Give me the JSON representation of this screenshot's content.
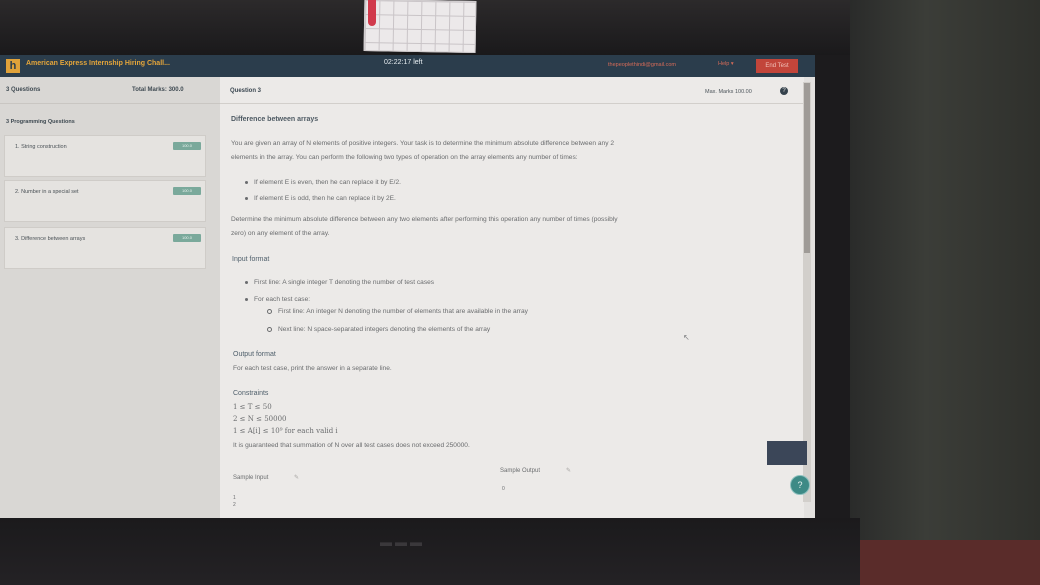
{
  "header": {
    "brand_letter": "h",
    "app_title": "American Express Internship Hiring Chall...",
    "timer": "02:22:17 left",
    "user_email": "thepeoplethindi@gmail.com",
    "help_label": "Help",
    "help_icon": "caret-down-icon",
    "end_test_label": "End Test"
  },
  "sidebar": {
    "questions_label": "3 Questions",
    "total_marks_label": "Total Marks: 300.0",
    "section_label": "3 Programming Questions",
    "items": [
      {
        "label": "1. String construction",
        "badge": "100.0"
      },
      {
        "label": "2. Number in a special set",
        "badge": "100.0"
      },
      {
        "label": "3. Difference between arrays",
        "badge": "100.0"
      }
    ]
  },
  "question": {
    "header_label": "Question 3",
    "max_marks": "Max. Marks 100.00",
    "title": "Difference between arrays",
    "intro_line1": "You are given an array of N elements of positive integers. Your task is to determine the minimum absolute difference between any 2",
    "intro_line2": "elements in the array. You can perform the following two types of operation on the array elements any number of times:",
    "ops": [
      "If element E is even, then he can replace it by E/2.",
      "If element E is odd, then he can replace it by 2E."
    ],
    "determine_line1": "Determine the minimum absolute difference between any two elements after performing this operation any number of times (possibly",
    "determine_line2": "zero) on any element of the array.",
    "input_format_title": "Input format",
    "input_first_line": "First line: A single integer T denoting the number of test cases",
    "input_for_each": "For each test case:",
    "input_sub1": "First line: An integer N denoting the number of elements that are available in the array",
    "input_sub2": "Next line: N space-separated integers denoting the elements of the array",
    "output_format_title": "Output format",
    "output_text": "For each test case, print the answer in a separate line.",
    "constraints_title": "Constraints",
    "constraints": [
      "1 ≤ T ≤ 50",
      "2 ≤ N ≤ 50000",
      "1 ≤ A[i] ≤ 10⁹ for each valid i",
      "It is guaranteed that summation of N over all test cases does not exceed 250000."
    ],
    "sample_input_label": "Sample Input",
    "sample_output_label": "Sample Output",
    "sample_input_values": [
      "1",
      "2"
    ],
    "sample_output_value": "0"
  },
  "colors": {
    "topbar": "#2b3d4c",
    "brand_accent": "#e0a23a",
    "end_test": "#c2453a",
    "badge": "#7aa99b",
    "chat_button": "#3d8a86"
  }
}
